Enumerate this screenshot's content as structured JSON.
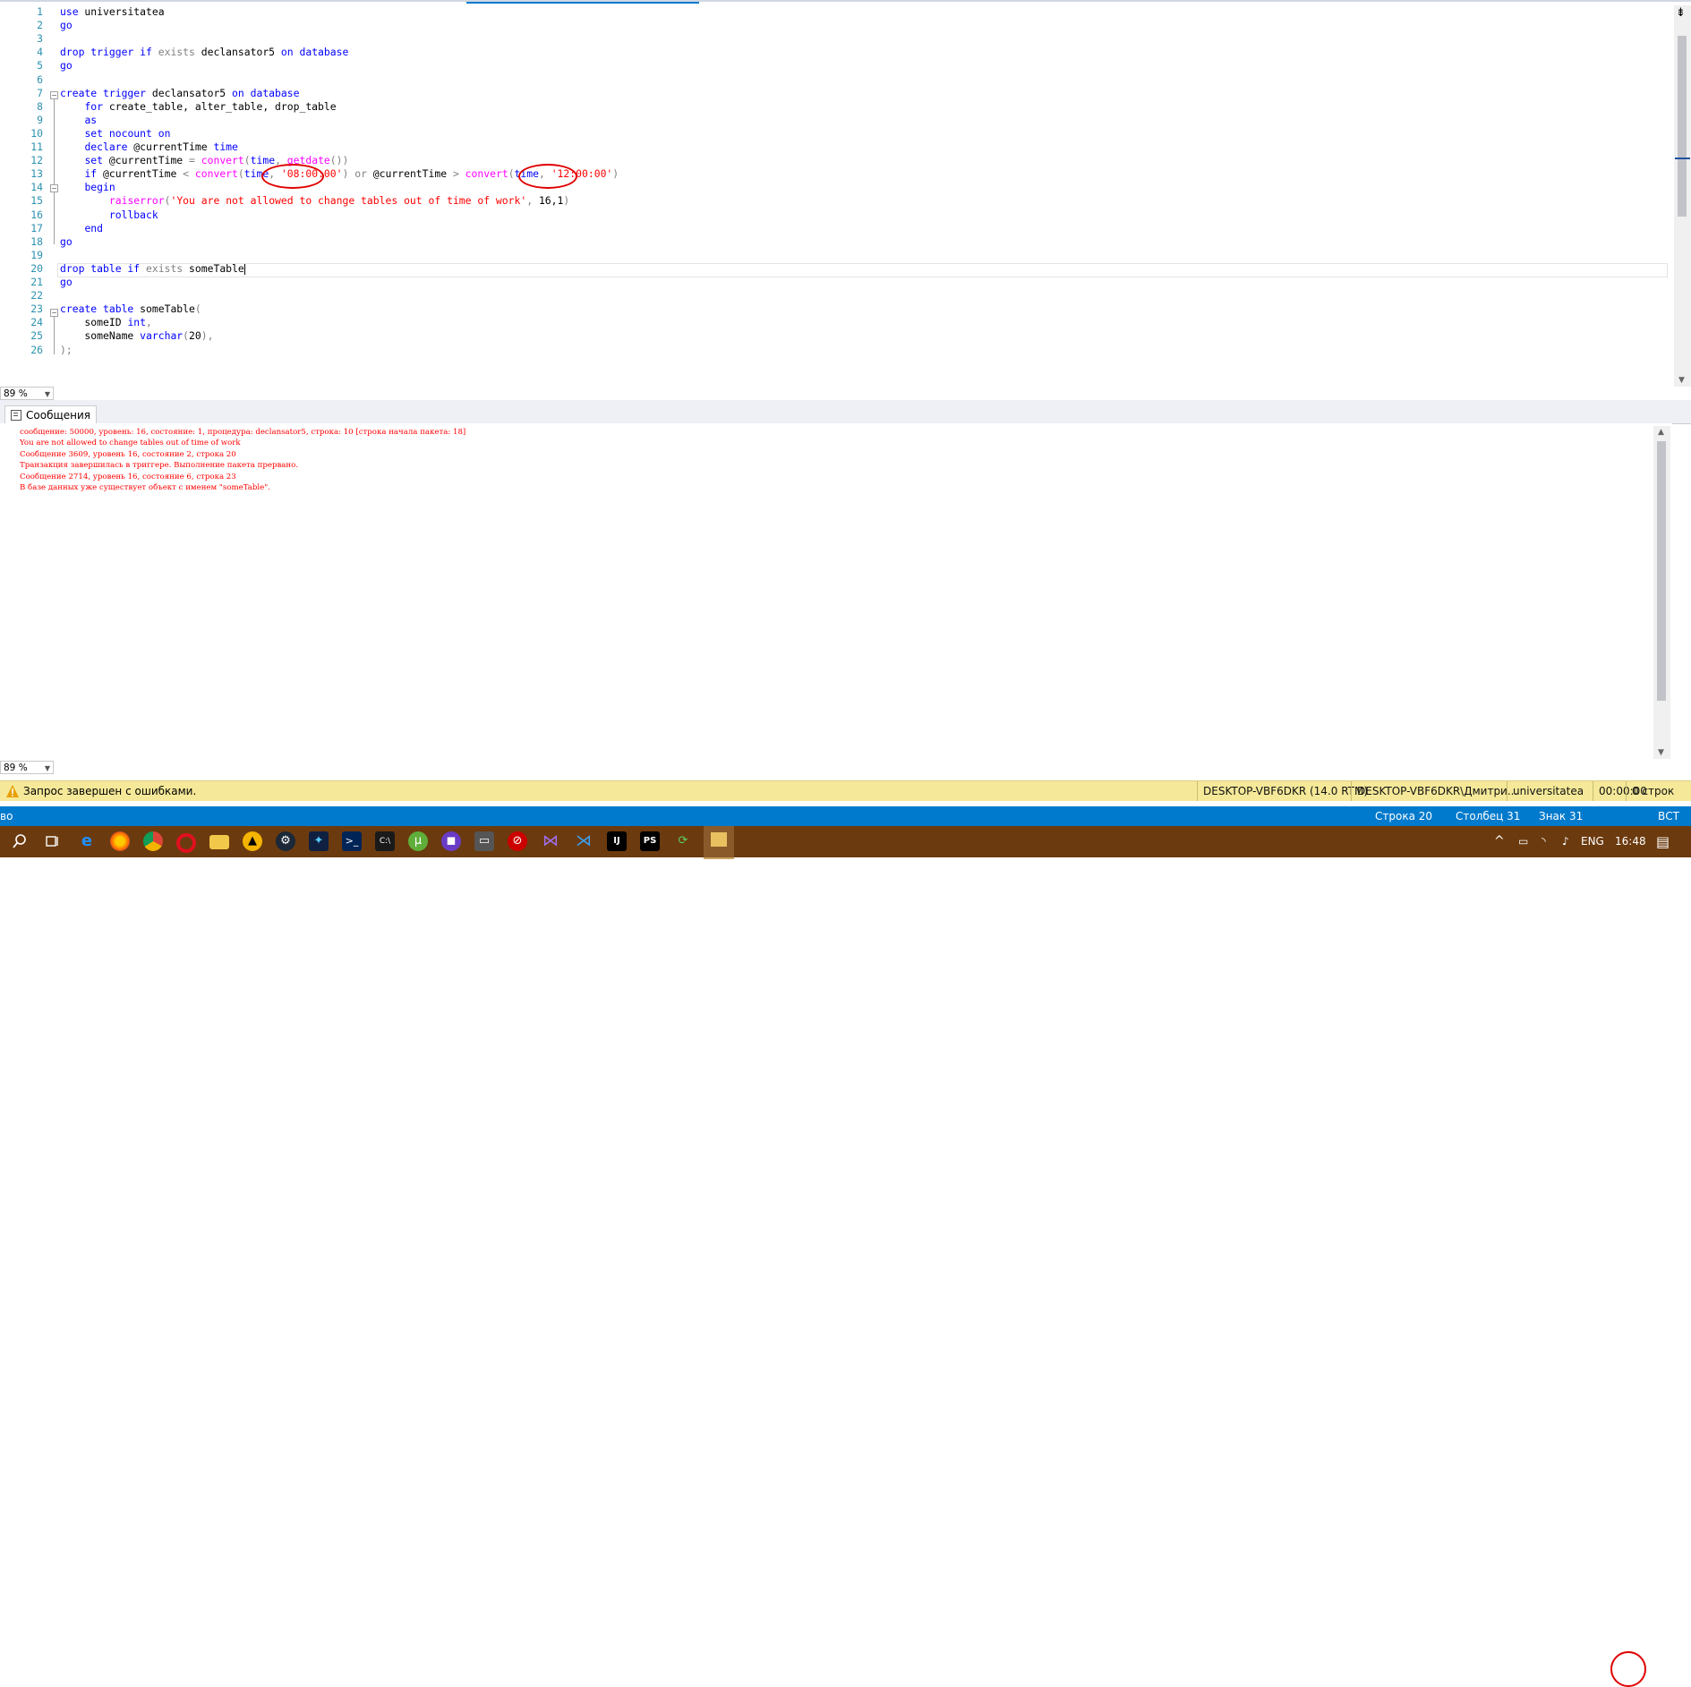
{
  "editor": {
    "lines": [
      {
        "n": "1",
        "tokens": [
          [
            "kw",
            "use"
          ],
          [
            "tx",
            " universitatea"
          ]
        ]
      },
      {
        "n": "2",
        "tokens": [
          [
            "kw",
            "go"
          ]
        ]
      },
      {
        "n": "3",
        "tokens": []
      },
      {
        "n": "4",
        "tokens": [
          [
            "kw",
            "drop trigger if "
          ],
          [
            "gr",
            "exists"
          ],
          [
            "tx",
            " declansator5 "
          ],
          [
            "kw",
            "on database"
          ]
        ]
      },
      {
        "n": "5",
        "tokens": [
          [
            "kw",
            "go"
          ]
        ]
      },
      {
        "n": "6",
        "tokens": []
      },
      {
        "n": "7",
        "tokens": [
          [
            "kw",
            "create trigger"
          ],
          [
            "tx",
            " declansator5 "
          ],
          [
            "kw",
            "on database"
          ]
        ]
      },
      {
        "n": "8",
        "tokens": [
          [
            "tx",
            "    "
          ],
          [
            "kw",
            "for"
          ],
          [
            "tx",
            " create_table, alter_table, drop_table"
          ]
        ]
      },
      {
        "n": "9",
        "tokens": [
          [
            "tx",
            "    "
          ],
          [
            "kw",
            "as"
          ]
        ]
      },
      {
        "n": "10",
        "tokens": [
          [
            "tx",
            "    "
          ],
          [
            "kw",
            "set nocount on"
          ]
        ]
      },
      {
        "n": "11",
        "tokens": [
          [
            "tx",
            "    "
          ],
          [
            "kw",
            "declare"
          ],
          [
            "tx",
            " @currentTime "
          ],
          [
            "kw",
            "time"
          ]
        ]
      },
      {
        "n": "12",
        "tokens": [
          [
            "tx",
            "    "
          ],
          [
            "kw",
            "set"
          ],
          [
            "tx",
            " @currentTime "
          ],
          [
            "gr",
            "= "
          ],
          [
            "fn",
            "convert"
          ],
          [
            "gr",
            "("
          ],
          [
            "kw",
            "time"
          ],
          [
            "gr",
            ", "
          ],
          [
            "fn",
            "getdate"
          ],
          [
            "gr",
            "())"
          ]
        ]
      },
      {
        "n": "13",
        "tokens": [
          [
            "tx",
            "    "
          ],
          [
            "kw",
            "if"
          ],
          [
            "tx",
            " @currentTime "
          ],
          [
            "gr",
            "< "
          ],
          [
            "fn",
            "convert"
          ],
          [
            "gr",
            "("
          ],
          [
            "kw",
            "time"
          ],
          [
            "gr",
            ", "
          ],
          [
            "str",
            "'08:00:00'"
          ],
          [
            "gr",
            ") or "
          ],
          [
            "tx",
            "@currentTime "
          ],
          [
            "gr",
            "> "
          ],
          [
            "fn",
            "convert"
          ],
          [
            "gr",
            "("
          ],
          [
            "kw",
            "time"
          ],
          [
            "gr",
            ", "
          ],
          [
            "str",
            "'12:00:00'"
          ],
          [
            "gr",
            ")"
          ]
        ]
      },
      {
        "n": "14",
        "tokens": [
          [
            "tx",
            "    "
          ],
          [
            "kw",
            "begin"
          ]
        ]
      },
      {
        "n": "15",
        "tokens": [
          [
            "tx",
            "        "
          ],
          [
            "fn",
            "raiserror"
          ],
          [
            "gr",
            "("
          ],
          [
            "str",
            "'You are not allowed to change tables out of time of work'"
          ],
          [
            "gr",
            ", "
          ],
          [
            "tx",
            "16,1"
          ],
          [
            "gr",
            ")"
          ]
        ]
      },
      {
        "n": "16",
        "tokens": [
          [
            "tx",
            "        "
          ],
          [
            "kw",
            "rollback"
          ]
        ]
      },
      {
        "n": "17",
        "tokens": [
          [
            "tx",
            "    "
          ],
          [
            "kw",
            "end"
          ]
        ]
      },
      {
        "n": "18",
        "tokens": [
          [
            "kw",
            "go"
          ]
        ]
      },
      {
        "n": "19",
        "tokens": []
      },
      {
        "n": "20",
        "tokens": [
          [
            "kw",
            "drop table if "
          ],
          [
            "gr",
            "exists"
          ],
          [
            "tx",
            " someTable"
          ]
        ]
      },
      {
        "n": "21",
        "tokens": [
          [
            "kw",
            "go"
          ]
        ]
      },
      {
        "n": "22",
        "tokens": []
      },
      {
        "n": "23",
        "tokens": [
          [
            "kw",
            "create table"
          ],
          [
            "tx",
            " someTable"
          ],
          [
            "gr",
            "("
          ]
        ]
      },
      {
        "n": "24",
        "tokens": [
          [
            "tx",
            "    someID "
          ],
          [
            "kw",
            "int"
          ],
          [
            "gr",
            ","
          ]
        ]
      },
      {
        "n": "25",
        "tokens": [
          [
            "tx",
            "    someName "
          ],
          [
            "kw",
            "varchar"
          ],
          [
            "gr",
            "("
          ],
          [
            "tx",
            "20"
          ],
          [
            "gr",
            "),"
          ]
        ]
      },
      {
        "n": "26",
        "tokens": [
          [
            "gr",
            ");"
          ]
        ]
      }
    ],
    "zoom": "89 %"
  },
  "results": {
    "tab_label": "Сообщения",
    "messages": [
      "сообщение: 50000, уровень: 16, состояние: 1, процедура: declansator5, строка: 10 [строка начала пакета: 18]",
      "You are not allowed to change tables out of time of work",
      "Сообщение 3609, уровень 16, состояние 2, строка 20",
      "Транзакция завершилась в триггере. Выполнение пакета прервано.",
      "Сообщение 2714, уровень 16, состояние 6, строка 23",
      "В базе данных уже существует объект с именем \"someTable\"."
    ],
    "zoom": "89 %"
  },
  "status": {
    "message": "Запрос завершен с ошибками.",
    "server": "DESKTOP-VBF6DKR (14.0 RTM)",
    "user": "DESKTOP-VBF6DKR\\Дмитри...",
    "database": "universitatea",
    "elapsed": "00:00:00",
    "rows": "0 строк"
  },
  "bottom_bar": {
    "left": "во",
    "row": "Строка 20",
    "col": "Столбец 31",
    "char": "Знак 31",
    "mode": "ВСТ"
  },
  "taskbar": {
    "lang": "ENG",
    "time": "16:48"
  }
}
